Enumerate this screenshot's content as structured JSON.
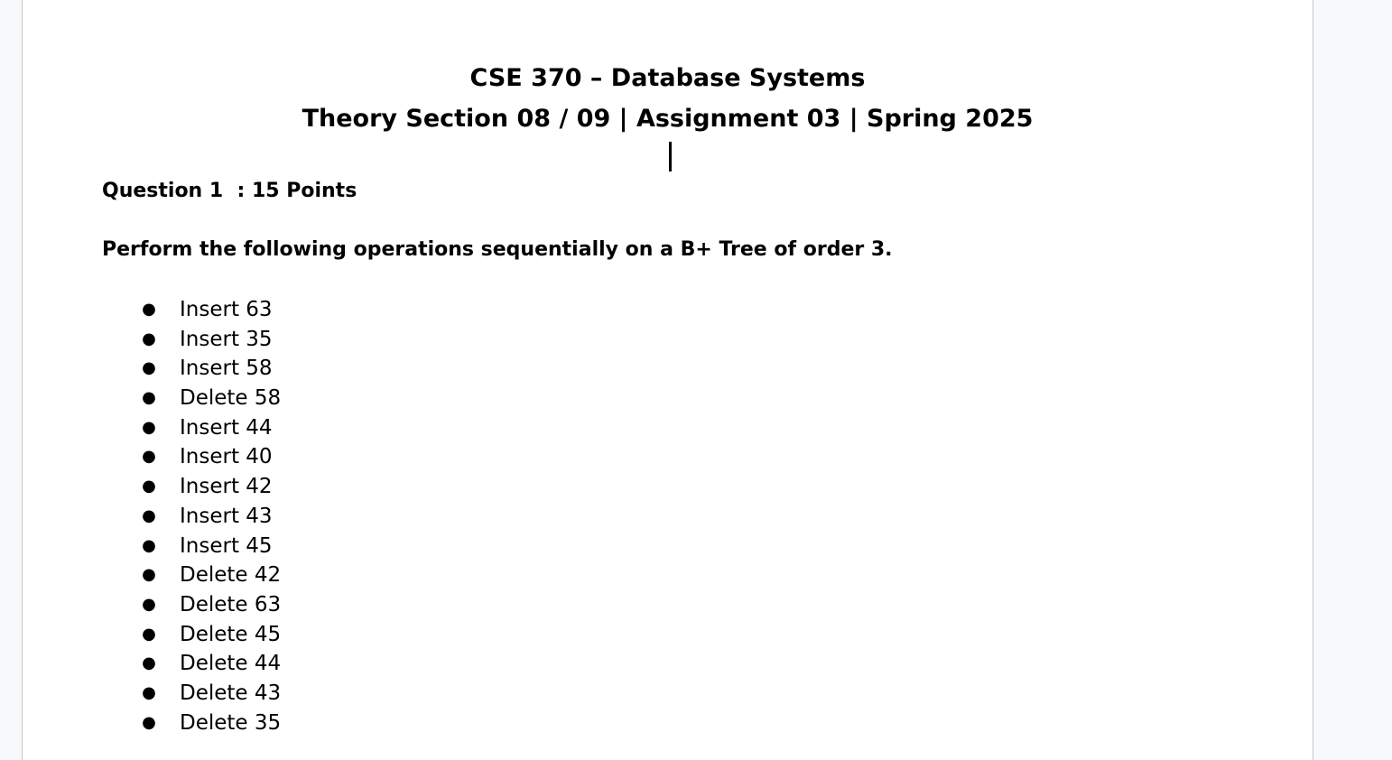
{
  "document": {
    "title": "CSE 370 – Database Systems",
    "subtitle": "Theory Section 08 / 09 | Assignment 03 | Spring 2025",
    "question_heading": "Question 1  : 15 Points",
    "instructions": "Perform the following operations sequentially on a B+ Tree of order 3.",
    "bullet_symbol": "●",
    "operations": [
      "Insert 63",
      "Insert 35",
      "Insert 58",
      "Delete 58",
      "Insert 44",
      "Insert 40",
      "Insert 42",
      "Insert 43",
      "Insert 45",
      "Delete 42",
      "Delete 63",
      "Delete 45",
      "Delete 44",
      "Delete 43",
      "Delete 35"
    ]
  },
  "colors": {
    "page_background": "#ffffff",
    "canvas_background": "#f8f9fa",
    "text": "#000000"
  }
}
